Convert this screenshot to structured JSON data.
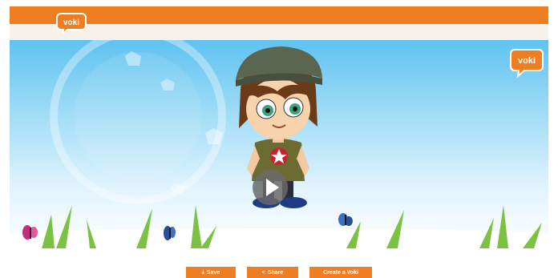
{
  "brand": {
    "logo_text": "voki"
  },
  "player": {
    "play_label": "Play"
  },
  "actions": {
    "save_label": "Save",
    "share_label": "Share",
    "create_label": "Create a Voki"
  },
  "colors": {
    "accent": "#ef7d22",
    "sky_top": "#5fc2f0",
    "grass": "#7cc242"
  },
  "icons": {
    "save": "download-icon",
    "share": "share-icon",
    "play": "play-icon"
  }
}
